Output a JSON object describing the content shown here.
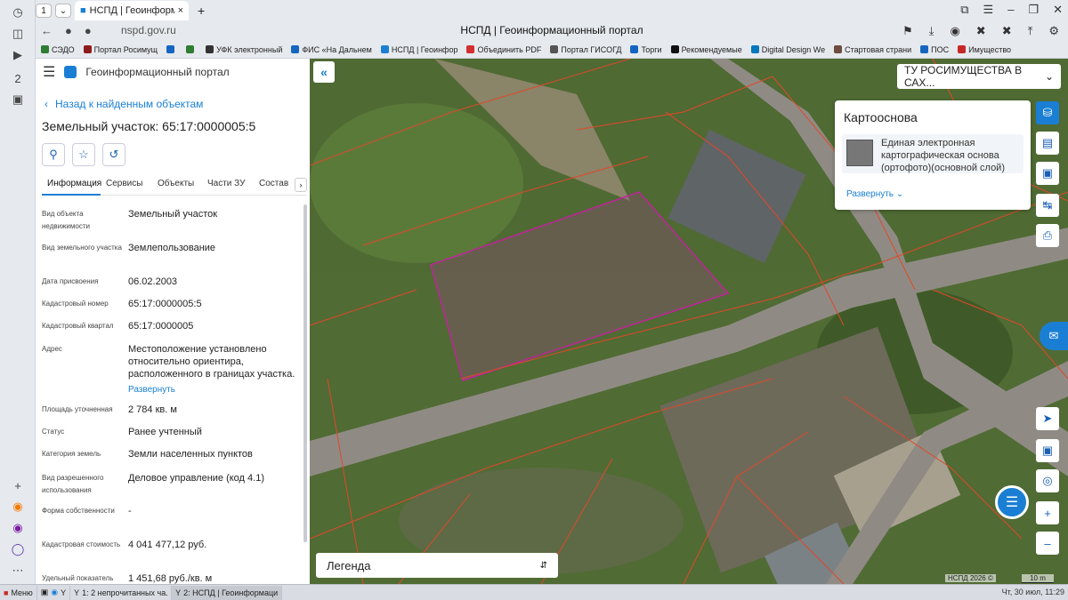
{
  "browser": {
    "tab_count": "1",
    "tab_title": "НСПД | Геоинформационн",
    "url": "nspd.gov.ru",
    "page_title": "НСПД | Геоинформационный портал",
    "bookmarks": [
      {
        "label": "СЭДО",
        "color": "#2e7d32"
      },
      {
        "label": "Портал Росимущ",
        "color": "#8e1b1b"
      },
      {
        "label": "",
        "color": "#1565c0"
      },
      {
        "label": "",
        "color": "#2e7d32"
      },
      {
        "label": "УФК электронный",
        "color": "#333"
      },
      {
        "label": "ФИС «На Дальнем",
        "color": "#1565c0"
      },
      {
        "label": "НСПД | Геоинфор",
        "color": "#1a7fd4"
      },
      {
        "label": "Объединить PDF",
        "color": "#d32f2f"
      },
      {
        "label": "Портал ГИСОГД",
        "color": "#555"
      },
      {
        "label": "Торги",
        "color": "#1565c0"
      },
      {
        "label": "Рекомендуемые",
        "color": "#111"
      },
      {
        "label": "Digital Design We",
        "color": "#0277bd"
      },
      {
        "label": "Стартовая страни",
        "color": "#6d4c41"
      },
      {
        "label": "ПОС",
        "color": "#1565c0"
      },
      {
        "label": "Имущество",
        "color": "#c62828"
      }
    ]
  },
  "portal": {
    "name": "Геоинформационный портал",
    "back_label": "Назад к найденным объектам",
    "object_title": "Земельный участок: 65:17:0000005:5",
    "tabs": [
      "Информация",
      "Сервисы",
      "Объекты",
      "Части ЗУ",
      "Состав"
    ],
    "rows": [
      {
        "label": "Вид объекта недвижимости",
        "value": "Земельный участок"
      },
      {
        "label": "Вид земельного участка",
        "value": "Землепользование"
      },
      {
        "label": "Дата присвоения",
        "value": "06.02.2003"
      },
      {
        "label": "Кадастровый номер",
        "value": "65:17:0000005:5"
      },
      {
        "label": "Кадастровый квартал",
        "value": "65:17:0000005"
      },
      {
        "label": "Адрес",
        "value": "Местоположение установлено относительно ориентира, расположенного в границах участка."
      },
      {
        "label": "Площадь уточненная",
        "value": "2 784 кв. м"
      },
      {
        "label": "Статус",
        "value": "Ранее учтенный"
      },
      {
        "label": "Категория земель",
        "value": "Земли населенных пунктов"
      },
      {
        "label": "Вид разрешенного использования",
        "value": "Деловое управление (код 4.1)"
      },
      {
        "label": "Форма собственности",
        "value": "-"
      },
      {
        "label": "Кадастровая стоимость",
        "value": "4 041 477,12 руб."
      },
      {
        "label": "Удельный показатель",
        "value": "1 451,68 руб./кв. м"
      }
    ],
    "expand_label": "Развернуть"
  },
  "map": {
    "region_select": "ТУ РОСИМУЩЕСТВА В САХ...",
    "basemap_title": "Картооснова",
    "basemap_layer": "Единая электронная картографическая основа (ортофото)(основной слой)",
    "basemap_expand": "Развернуть",
    "legend_label": "Легенда",
    "attribution": "НСПД 2026 ©",
    "scale_label": "10 m"
  },
  "taskbar": {
    "start_label": "Меню",
    "items": [
      "1: 2 непрочитанных ча...",
      "2: НСПД | Геоинформаци..."
    ],
    "clock": "Чт, 30 июл, 11:29"
  },
  "colors": {
    "accent": "#1a7fd4",
    "parcel": "#c0249a",
    "boundaries": "#e0482a"
  }
}
